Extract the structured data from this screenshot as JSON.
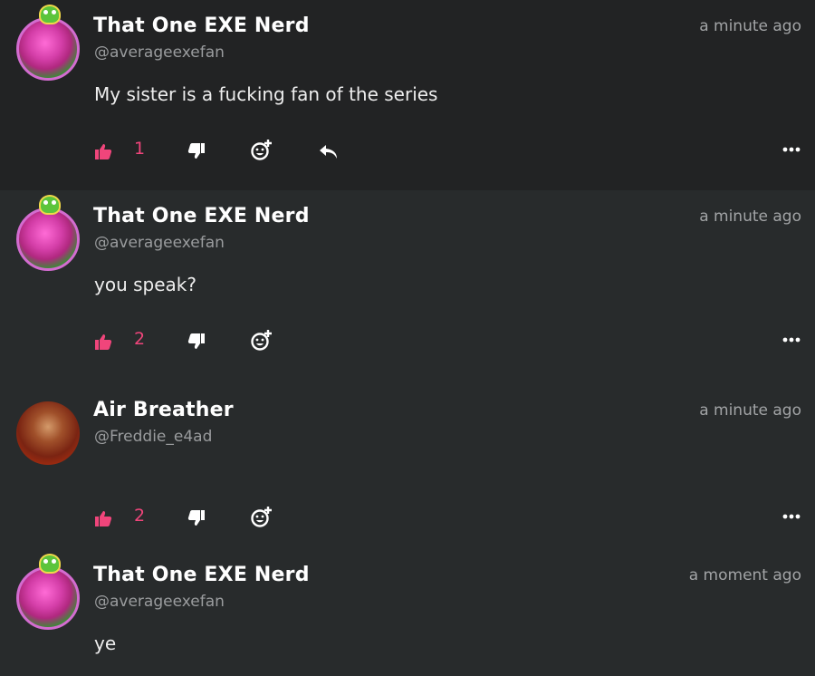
{
  "colors": {
    "accent": "#f0457b",
    "background": "#272a2b",
    "text_muted": "#9a9c9e"
  },
  "comments": [
    {
      "author": "That One EXE Nerd",
      "handle": "@averageexefan",
      "time": "a minute ago",
      "text": "My sister is a fucking fan of the series",
      "likes": "1",
      "avatar": "pink-character-avatar",
      "has_reply": true
    },
    {
      "author": "That One EXE Nerd",
      "handle": "@averageexefan",
      "time": "a minute ago",
      "text": "you speak?",
      "likes": "2",
      "avatar": "pink-character-avatar",
      "has_reply": false
    },
    {
      "author": "Air Breather",
      "handle": "@Freddie_e4ad",
      "time": "a minute ago",
      "text": "",
      "likes": "2",
      "avatar": "skull-avatar",
      "has_reply": false
    },
    {
      "author": "That One EXE Nerd",
      "handle": "@averageexefan",
      "time": "a moment ago",
      "text": "ye",
      "avatar": "pink-character-avatar"
    }
  ],
  "icons": {
    "like": "thumbs-up-icon",
    "dislike": "thumbs-down-icon",
    "react": "add-emoji-icon",
    "reply": "reply-arrow-icon",
    "more": "more-dots-icon"
  }
}
